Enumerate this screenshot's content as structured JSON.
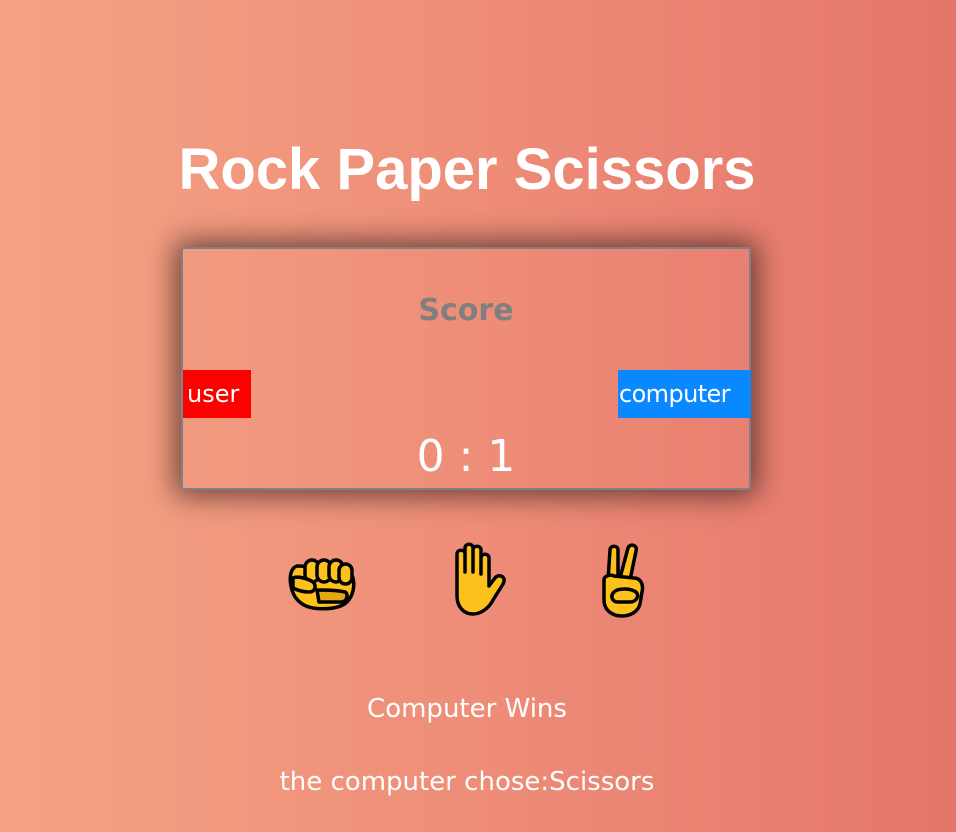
{
  "app": {
    "title": "Rock Paper Scissors"
  },
  "scoreboard": {
    "label": "Score",
    "user_label": "user",
    "computer_label": "computer",
    "score": "0 : 1",
    "user_score": 0,
    "computer_score": 1,
    "colors": {
      "user_badge": "#ff0000",
      "computer_badge": "#0a88ff",
      "label_text": "#7f7f7f",
      "border": "#7f8186"
    }
  },
  "choices": [
    {
      "name": "rock",
      "icon": "fist-icon"
    },
    {
      "name": "paper",
      "icon": "raised-hand-icon"
    },
    {
      "name": "scissors",
      "icon": "victory-hand-icon"
    }
  ],
  "result": {
    "message": "Computer Wins",
    "computer_choice_text": "the computer chose:Scissors"
  },
  "theme": {
    "background_start": "#f5a384",
    "background_end": "#e5756b",
    "emoji_fill": "#fcc21b",
    "emoji_stroke": "#000000"
  }
}
